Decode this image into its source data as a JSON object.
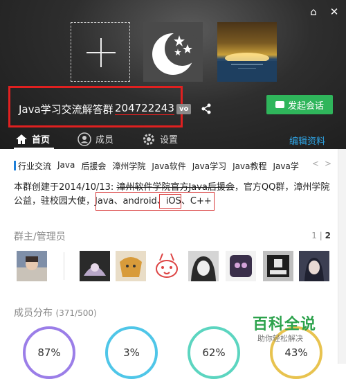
{
  "window": {
    "controls": [
      "skin-icon",
      "close-icon"
    ]
  },
  "header": {
    "group_name": "Java学习交流解答群",
    "group_id": "204722243",
    "vip_badge": "vo",
    "start_chat_label": "发起会话"
  },
  "nav": {
    "items": [
      {
        "label": "首页",
        "icon": "home-icon",
        "active": true
      },
      {
        "label": "成员",
        "icon": "member-icon",
        "active": false
      },
      {
        "label": "设置",
        "icon": "gear-icon",
        "active": false
      }
    ],
    "edit_label": "编辑资料"
  },
  "tags": [
    "行业交流",
    "Java",
    "后援会",
    "漳州学院",
    "Java软件",
    "Java学习",
    "Java教程",
    "Java学"
  ],
  "tag_arrows": [
    "<",
    ">"
  ],
  "description": {
    "prefix": "本群创建于2014/10/13: ",
    "struck": "漳州软件学院官方Java后援会",
    "line1_rest": "，官方QQ群，漳州学院",
    "line2_start": "公益，驻校园大使，",
    "line2_langs": "Java、android、",
    "line2_ios": "iOS",
    "line2_end": "、C++"
  },
  "admins": {
    "title": "群主/管理员",
    "pager_current": "1",
    "pager_sep": "|",
    "pager_next": "2"
  },
  "distribution": {
    "title": "成员分布",
    "count": "(371/500)",
    "stats": [
      {
        "value": "87%",
        "color": "#9b7ee8"
      },
      {
        "value": "3%",
        "color": "#4fc6e8"
      },
      {
        "value": "62%",
        "color": "#5cd5c0"
      },
      {
        "value": "43%",
        "color": "#e8c34f"
      }
    ]
  },
  "watermark": {
    "title": "百科全说",
    "subtitle": "助你轻松解决"
  }
}
